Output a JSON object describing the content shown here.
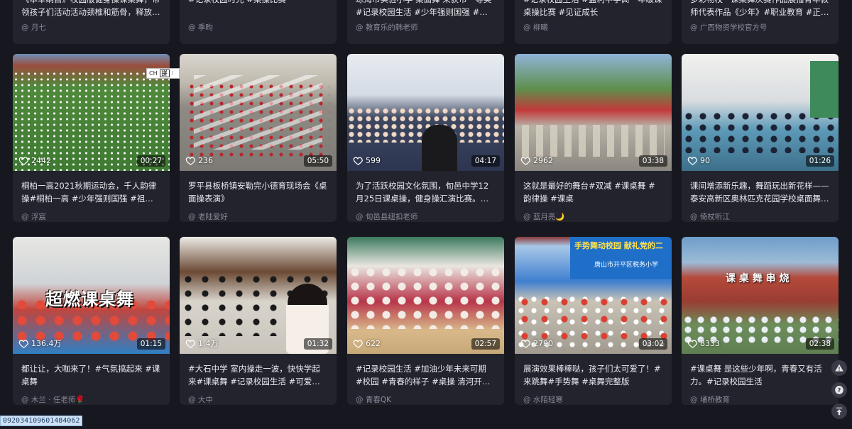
{
  "top_row": [
    {
      "title": "《本草纲目》校园版健身操课桌舞，带领孩子们活动活动颈椎和筋骨，释放学习…",
      "author": "@ 月七"
    },
    {
      "title": "#记录校园时光 #桌操比赛",
      "author": "@ 季昀"
    },
    {
      "title": "琼海市实验小学 桌面舞 荣获市一等奖#记录校园生活 #少年强则国强 #校园活动 …",
      "author": "@ 教育乐的韩老师"
    },
    {
      "title": "#记录校园生活 #监利中学高一年级课桌操比赛 #见证成长",
      "author": "@ 柳曦"
    },
    {
      "title": "多彩物校 · 课桌舞决赛作品展播青年教师代表作品《少年》#职业教育 #正青春不…",
      "author": "@ 广西物资学校官方号"
    }
  ],
  "videos": [
    {
      "likes": "2442",
      "duration": "00:27",
      "title": "桐柏一高2021秋期运动会，千人韵律操#桐柏一高 #少年强则国强 #祖国的花朵…",
      "author": "@ 浮宸"
    },
    {
      "likes": "236",
      "duration": "05:50",
      "title": "罗平县板桥镇安勒完小德育现场会《桌面操表演》",
      "author": "@ 老陆爱好"
    },
    {
      "likes": "599",
      "duration": "04:17",
      "title": "为了活跃校园文化氛围，旬邑中学12月25日课桌操，健身操汇演比赛。静待佳…",
      "author": "@ 旬邑县纽扣老师"
    },
    {
      "likes": "2962",
      "duration": "03:38",
      "title": "这就是最好的舞台#双减 #课桌舞 #韵律操 #课桌",
      "author": "@ 蓝月亮🌙"
    },
    {
      "likes": "90",
      "duration": "01:26",
      "title": "课间增添新乐趣，舞蹈玩出新花样——泰安高新区奥林匹克花园学校桌面舞展示…",
      "author": "@ 倚杖听江"
    },
    {
      "likes": "136.4万",
      "duration": "01:15",
      "title": "都让让，大咖来了！#气氛搞起来 #课桌舞",
      "author": "@ 木兰 · 任老师🌹",
      "overlay": "超燃课桌舞"
    },
    {
      "likes": "1.4万",
      "duration": "01:32",
      "title": "#大石中学 室内操走一波，快快学起来#课桌舞 #记录校园生活 #可爱的孩子们棒…",
      "author": "@ 大中"
    },
    {
      "likes": "622",
      "duration": "02:57",
      "title": "#记录校园生活 #加油少年未来可期 #校园 #青春的样子 #桌操 清河开明中学桌操…",
      "author": "@ 青春QK"
    },
    {
      "likes": "2790",
      "duration": "03:02",
      "title": "展演效果棒棒哒，孩子们太可爱了！#来跳舞#手势舞 #桌舞完整版",
      "author": "@ 水陌轻寒",
      "overlay": "手势舞动校园 献礼党的二",
      "overlay2": "唐山市开平区税务小学"
    },
    {
      "likes": "8333",
      "duration": "02:38",
      "title": "#课桌舞 是这些少年啊，青春又有活力。#记录校园生活",
      "author": "@ 埇桥教育",
      "overlay": "课 桌 舞 串 烧"
    }
  ],
  "ime": {
    "label": "CH",
    "glyph": "拼"
  },
  "footer_id": "09203410960148406​2",
  "icons": {
    "like": "heart-outline-icon",
    "warn": "warning-icon",
    "help": "help-icon",
    "top": "back-to-top-icon"
  }
}
